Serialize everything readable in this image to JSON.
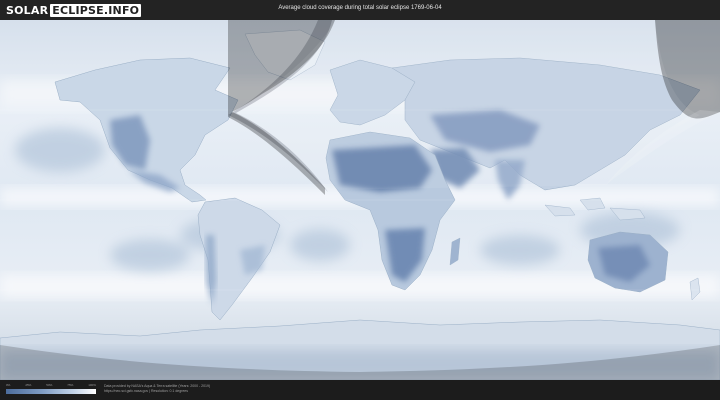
{
  "header": {
    "logo_part1": "SOLAR",
    "logo_part2": "ECLIPSE.INFO",
    "title": "Average cloud coverage during total solar eclipse 1769-06-04"
  },
  "map": {
    "colors": {
      "ocean_base": "#dfe8f2",
      "cloud_white": "#f6f8fb",
      "clear_sky": "#6e89b3",
      "night_shade": "#000000"
    },
    "map_type": "equirectangular world map, cloud coverage"
  },
  "legend": {
    "ticks": [
      "0%",
      "25%",
      "50%",
      "75%",
      "100%"
    ],
    "gradient": [
      "#4d6d9c",
      "#7f9cc3",
      "#c2d3e8",
      "#ffffff"
    ]
  },
  "footer": {
    "credit_line1": "Data provided by NASA's Aqua & Terra satellite (Years: 2000 - 2019)",
    "credit_line2": "https://neo.sci.gsfc.nasa.gov | Resolution: 0.1 degrees"
  }
}
